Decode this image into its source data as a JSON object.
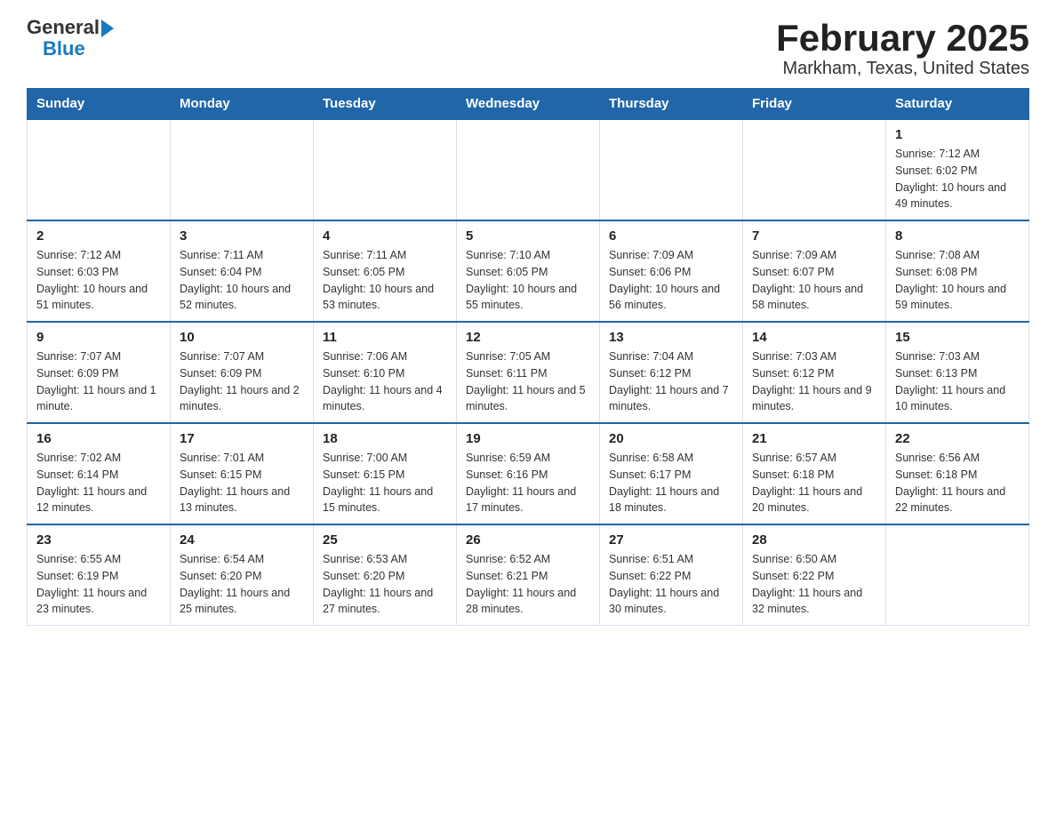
{
  "logo": {
    "general": "General",
    "blue": "Blue"
  },
  "title": "February 2025",
  "subtitle": "Markham, Texas, United States",
  "weekdays": [
    "Sunday",
    "Monday",
    "Tuesday",
    "Wednesday",
    "Thursday",
    "Friday",
    "Saturday"
  ],
  "weeks": [
    [
      {
        "day": "",
        "info": ""
      },
      {
        "day": "",
        "info": ""
      },
      {
        "day": "",
        "info": ""
      },
      {
        "day": "",
        "info": ""
      },
      {
        "day": "",
        "info": ""
      },
      {
        "day": "",
        "info": ""
      },
      {
        "day": "1",
        "info": "Sunrise: 7:12 AM\nSunset: 6:02 PM\nDaylight: 10 hours\nand 49 minutes."
      }
    ],
    [
      {
        "day": "2",
        "info": "Sunrise: 7:12 AM\nSunset: 6:03 PM\nDaylight: 10 hours\nand 51 minutes."
      },
      {
        "day": "3",
        "info": "Sunrise: 7:11 AM\nSunset: 6:04 PM\nDaylight: 10 hours\nand 52 minutes."
      },
      {
        "day": "4",
        "info": "Sunrise: 7:11 AM\nSunset: 6:05 PM\nDaylight: 10 hours\nand 53 minutes."
      },
      {
        "day": "5",
        "info": "Sunrise: 7:10 AM\nSunset: 6:05 PM\nDaylight: 10 hours\nand 55 minutes."
      },
      {
        "day": "6",
        "info": "Sunrise: 7:09 AM\nSunset: 6:06 PM\nDaylight: 10 hours\nand 56 minutes."
      },
      {
        "day": "7",
        "info": "Sunrise: 7:09 AM\nSunset: 6:07 PM\nDaylight: 10 hours\nand 58 minutes."
      },
      {
        "day": "8",
        "info": "Sunrise: 7:08 AM\nSunset: 6:08 PM\nDaylight: 10 hours\nand 59 minutes."
      }
    ],
    [
      {
        "day": "9",
        "info": "Sunrise: 7:07 AM\nSunset: 6:09 PM\nDaylight: 11 hours\nand 1 minute."
      },
      {
        "day": "10",
        "info": "Sunrise: 7:07 AM\nSunset: 6:09 PM\nDaylight: 11 hours\nand 2 minutes."
      },
      {
        "day": "11",
        "info": "Sunrise: 7:06 AM\nSunset: 6:10 PM\nDaylight: 11 hours\nand 4 minutes."
      },
      {
        "day": "12",
        "info": "Sunrise: 7:05 AM\nSunset: 6:11 PM\nDaylight: 11 hours\nand 5 minutes."
      },
      {
        "day": "13",
        "info": "Sunrise: 7:04 AM\nSunset: 6:12 PM\nDaylight: 11 hours\nand 7 minutes."
      },
      {
        "day": "14",
        "info": "Sunrise: 7:03 AM\nSunset: 6:12 PM\nDaylight: 11 hours\nand 9 minutes."
      },
      {
        "day": "15",
        "info": "Sunrise: 7:03 AM\nSunset: 6:13 PM\nDaylight: 11 hours\nand 10 minutes."
      }
    ],
    [
      {
        "day": "16",
        "info": "Sunrise: 7:02 AM\nSunset: 6:14 PM\nDaylight: 11 hours\nand 12 minutes."
      },
      {
        "day": "17",
        "info": "Sunrise: 7:01 AM\nSunset: 6:15 PM\nDaylight: 11 hours\nand 13 minutes."
      },
      {
        "day": "18",
        "info": "Sunrise: 7:00 AM\nSunset: 6:15 PM\nDaylight: 11 hours\nand 15 minutes."
      },
      {
        "day": "19",
        "info": "Sunrise: 6:59 AM\nSunset: 6:16 PM\nDaylight: 11 hours\nand 17 minutes."
      },
      {
        "day": "20",
        "info": "Sunrise: 6:58 AM\nSunset: 6:17 PM\nDaylight: 11 hours\nand 18 minutes."
      },
      {
        "day": "21",
        "info": "Sunrise: 6:57 AM\nSunset: 6:18 PM\nDaylight: 11 hours\nand 20 minutes."
      },
      {
        "day": "22",
        "info": "Sunrise: 6:56 AM\nSunset: 6:18 PM\nDaylight: 11 hours\nand 22 minutes."
      }
    ],
    [
      {
        "day": "23",
        "info": "Sunrise: 6:55 AM\nSunset: 6:19 PM\nDaylight: 11 hours\nand 23 minutes."
      },
      {
        "day": "24",
        "info": "Sunrise: 6:54 AM\nSunset: 6:20 PM\nDaylight: 11 hours\nand 25 minutes."
      },
      {
        "day": "25",
        "info": "Sunrise: 6:53 AM\nSunset: 6:20 PM\nDaylight: 11 hours\nand 27 minutes."
      },
      {
        "day": "26",
        "info": "Sunrise: 6:52 AM\nSunset: 6:21 PM\nDaylight: 11 hours\nand 28 minutes."
      },
      {
        "day": "27",
        "info": "Sunrise: 6:51 AM\nSunset: 6:22 PM\nDaylight: 11 hours\nand 30 minutes."
      },
      {
        "day": "28",
        "info": "Sunrise: 6:50 AM\nSunset: 6:22 PM\nDaylight: 11 hours\nand 32 minutes."
      },
      {
        "day": "",
        "info": ""
      }
    ]
  ]
}
